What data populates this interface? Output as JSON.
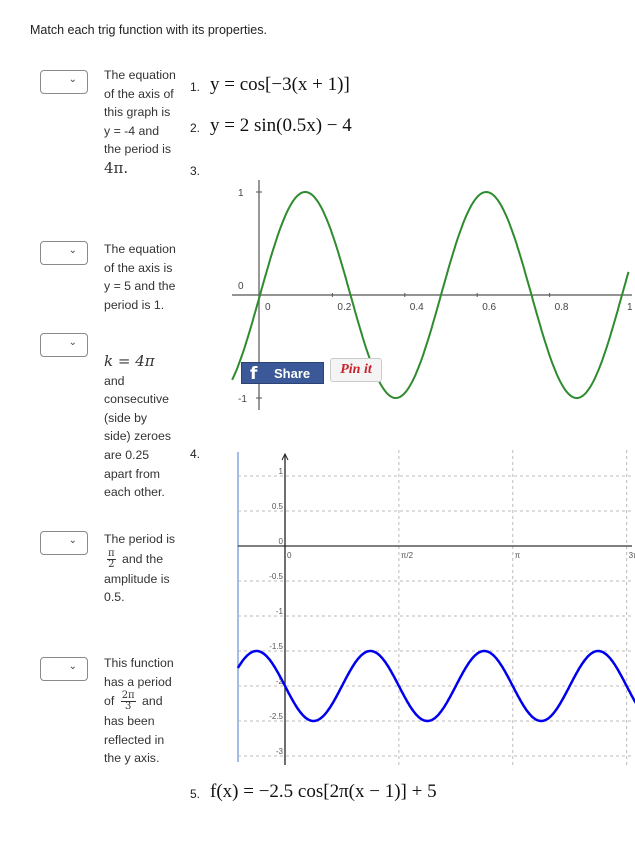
{
  "instruction": "Match each trig function with its properties.",
  "select_chevron": "⌄",
  "prompts": [
    {
      "text": "The equation of the axis of this graph is y = -4 and the period is",
      "math": "4π."
    },
    {
      "text": "The equation of the axis is y = 5 and the period is 1."
    },
    {
      "math": "k = 4π",
      "text": "and consecutive (side by side) zeroes are 0.25 apart from each other."
    },
    {
      "pre": "The period is",
      "frac_num": "π",
      "frac_den": "2",
      "post": "and the amplitude is 0.5."
    },
    {
      "pre": "This function has a period of",
      "frac_num": "2π",
      "frac_den": "3",
      "post": "and has been reflected in the y axis."
    }
  ],
  "options": [
    {
      "number": "1.",
      "equation": "y = cos[−3(x + 1)]"
    },
    {
      "number": "2.",
      "equation": "y = 2 sin(0.5x) − 4"
    },
    {
      "number": "3."
    },
    {
      "number": "4."
    },
    {
      "number": "5.",
      "equation": "f(x) = −2.5 cos[2π(x − 1)] + 5"
    }
  ],
  "share": {
    "facebook_icon": "f",
    "facebook_label": "Share",
    "pinterest_label": "Pin it"
  },
  "chart_data": [
    {
      "type": "line",
      "function": "y = sin(4πx)",
      "x_ticks": [
        "0",
        "0.2",
        "0.4",
        "0.6",
        "0.8",
        "1"
      ],
      "y_ticks": [
        "1",
        "0",
        "-1"
      ],
      "xlim": [
        -0.08,
        1.02
      ],
      "ylim": [
        -1.05,
        1.2
      ],
      "color": "#2e8b2e",
      "grid": false
    },
    {
      "type": "line",
      "function": "y = -2 - 0.5 sin(4x)",
      "x_ticks": [
        "0",
        "π/2",
        "π",
        "3π"
      ],
      "y_ticks": [
        "1",
        "0.5",
        "0",
        "-0.5",
        "-1",
        "-1.5",
        "-2",
        "-2.5",
        "-3"
      ],
      "xlim": [
        -0.65,
        4.9
      ],
      "ylim": [
        -3.1,
        1.3
      ],
      "color": "#0000ee",
      "grid": true
    }
  ]
}
